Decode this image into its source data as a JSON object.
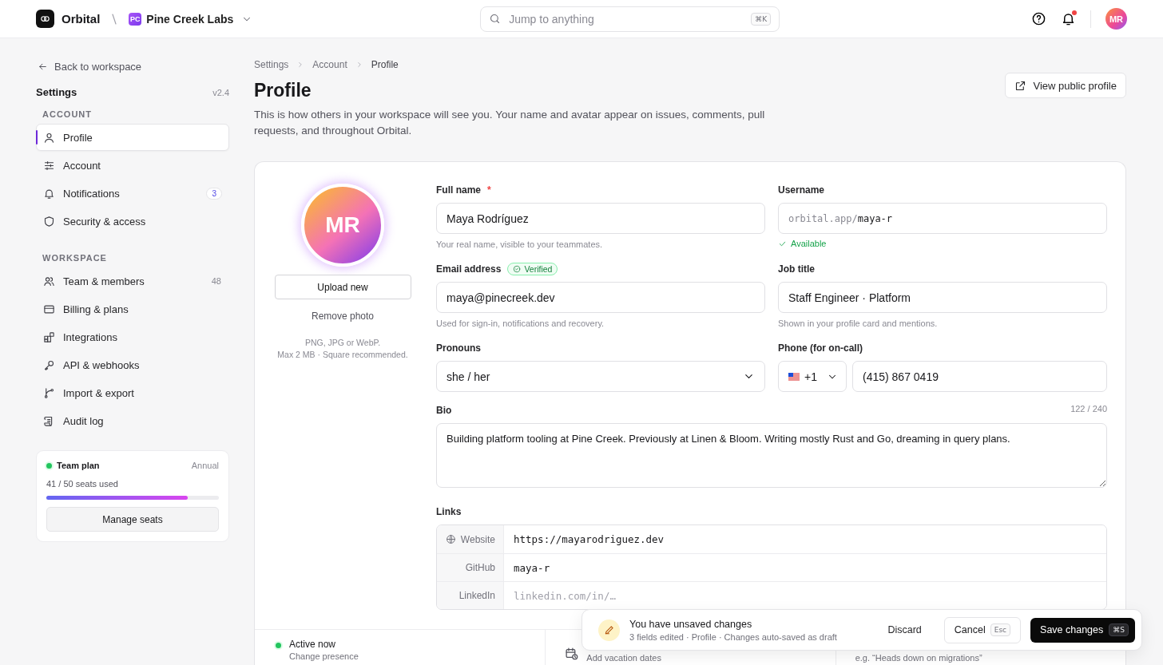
{
  "topbar": {
    "app_name": "Orbital",
    "workspace": {
      "initials": "PC",
      "name": "Pine Creek Labs"
    },
    "search": {
      "placeholder": "Jump to anything",
      "shortcut": "⌘K"
    },
    "notifications_unread": true,
    "user_initials": "MR"
  },
  "sidebar": {
    "back_link": "Back to workspace",
    "title": "Settings",
    "version": "v2.4",
    "sections": [
      {
        "heading": "ACCOUNT",
        "items": [
          {
            "label": "Profile",
            "selected": true
          },
          {
            "label": "Account",
            "selected": false
          },
          {
            "label": "Notifications",
            "selected": false,
            "badge": "3"
          },
          {
            "label": "Security & access",
            "selected": false
          }
        ]
      },
      {
        "heading": "WORKSPACE",
        "items": [
          {
            "label": "Team & members",
            "selected": false,
            "count": "48"
          },
          {
            "label": "Billing & plans",
            "selected": false
          },
          {
            "label": "Integrations",
            "selected": false
          },
          {
            "label": "API & webhooks",
            "selected": false
          },
          {
            "label": "Import & export",
            "selected": false
          },
          {
            "label": "Audit log",
            "selected": false
          }
        ]
      }
    ],
    "plan": {
      "name": "Team plan",
      "color": "#22c55e",
      "billing": "Annual",
      "usage": "41 / 50 seats used",
      "level": 0.82,
      "button": "Manage seats"
    }
  },
  "main": {
    "breadcrumb": [
      "Settings",
      "Account",
      "Profile"
    ],
    "title": "Profile",
    "description": "This is how others in your workspace will see you. Your name and avatar appear on issues, comments, pull requests, and throughout Orbital.",
    "view_button": "View public profile",
    "card": {
      "avatar": {
        "initials": "MR",
        "upload_button": "Upload new",
        "remove_link": "Remove photo",
        "hint": [
          "PNG, JPG or WebP.",
          "Max 2 MB · Square recommended."
        ]
      },
      "full_name": {
        "label": "Full name",
        "required_mark": "*",
        "value": "Maya Rodríguez",
        "help": "Your real name, visible to your teammates."
      },
      "username": {
        "label": "Username",
        "prefix": "orbital.app/",
        "value": "maya-r",
        "status": "Available"
      },
      "email": {
        "label": "Email address",
        "badge": "Verified",
        "value": "maya@pinecreek.dev",
        "help": "Used for sign-in, notifications and recovery."
      },
      "job_title": {
        "label": "Job title",
        "value": "Staff Engineer · Platform",
        "help": "Shown in your profile card and mentions."
      },
      "pronouns": {
        "label": "Pronouns",
        "value": "she / her"
      },
      "phone": {
        "label": "Phone (for on-call)",
        "country_code": "+1",
        "number": "(415) 867 0419"
      },
      "bio": {
        "label": "Bio",
        "counter": "122 / 240",
        "value": "Building platform tooling at Pine Creek. Previously at Linen & Bloom. Writing mostly Rust and Go, dreaming in query plans."
      },
      "links": {
        "label": "Links",
        "rows": [
          {
            "kind": "website",
            "label": "Website",
            "value": "https://mayarodriguez.dev"
          },
          {
            "kind": "plain",
            "label": "GitHub",
            "value": "maya-r"
          },
          {
            "kind": "plain",
            "label": "LinkedIn",
            "placeholder": "linkedin.com/in/…"
          }
        ]
      },
      "footer": [
        {
          "kind": "presence",
          "title": "Active now",
          "subtitle": "Change presence",
          "color": "#22c55e"
        },
        {
          "kind": "vacation",
          "subtitle": "Add vacation dates"
        },
        {
          "kind": "status",
          "subtitle": "e.g. “Heads down on migrations”"
        }
      ]
    }
  },
  "toast": {
    "title": "You have unsaved changes",
    "detail": "3 fields edited · Profile · Changes auto-saved as draft",
    "discard": "Discard",
    "cancel": {
      "label": "Cancel",
      "key": "Esc"
    },
    "save": {
      "label": "Save changes",
      "key": "⌘S"
    }
  }
}
